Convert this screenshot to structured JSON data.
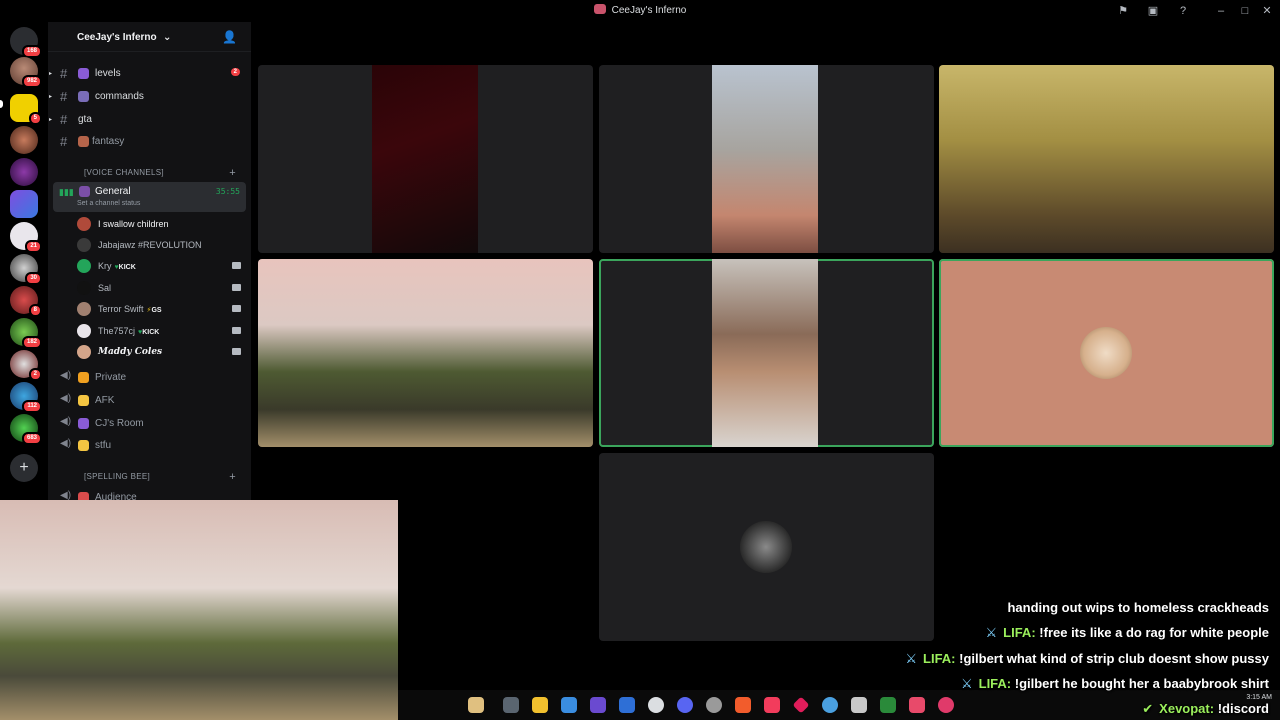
{
  "window": {
    "title": "CeeJay's Inferno"
  },
  "rail": {
    "servers": [
      {
        "icon": "discord-icon",
        "badge": "168"
      },
      {
        "icon": "server-avatar-icon",
        "badge": "982"
      },
      {
        "icon": "server-w-icon",
        "badge": "5"
      },
      {
        "icon": "server-avatar-icon",
        "badge": ""
      },
      {
        "icon": "server-avatar-icon",
        "badge": ""
      },
      {
        "icon": "server-andi-icon",
        "badge": ""
      },
      {
        "icon": "server-bunny-icon",
        "badge": "21"
      },
      {
        "icon": "server-avatar-icon",
        "badge": "30"
      },
      {
        "icon": "server-avatar-icon",
        "badge": "8"
      },
      {
        "icon": "server-avatar-icon",
        "badge": "182"
      },
      {
        "icon": "server-avatar-icon",
        "badge": "2"
      },
      {
        "icon": "server-avatar-icon",
        "badge": "112"
      },
      {
        "icon": "server-avatar-icon",
        "badge": "683"
      }
    ],
    "add_server_icon": "plus-icon"
  },
  "sidebar": {
    "server_name": "CeeJay's Inferno",
    "channels": [
      {
        "name": "levels",
        "count": "2"
      },
      {
        "name": "commands",
        "count": ""
      },
      {
        "name": "gta",
        "count": ""
      },
      {
        "name": "fantasy",
        "count": ""
      }
    ],
    "voice_category": "[VOICE CHANNELS]",
    "active_voice": {
      "name": "General",
      "time": "35:55",
      "status": "Set a channel status"
    },
    "members": [
      {
        "name": "I swallow children",
        "tag": "",
        "cam": false
      },
      {
        "name": "Jabajawz #REVOLUTION",
        "tag": "",
        "cam": false
      },
      {
        "name": "Kry",
        "tag": "KICK",
        "cam": true
      },
      {
        "name": "Sal",
        "tag": "",
        "cam": true
      },
      {
        "name": "Terror Swift",
        "tag": "GS",
        "cam": true
      },
      {
        "name": "The757cj",
        "tag": "KICK",
        "cam": true
      },
      {
        "name": "Maddy Coles",
        "tag": "",
        "cam": true
      }
    ],
    "voice_channels": [
      {
        "name": "Private"
      },
      {
        "name": "AFK"
      },
      {
        "name": "CJ's Room"
      },
      {
        "name": "stfu"
      }
    ],
    "spelling_category": "[SPELLING BEE]",
    "audience": "Audience"
  },
  "chat": [
    {
      "user": "",
      "text": "handing out wips to homeless crackheads"
    },
    {
      "user": "LIFA:",
      "text": "!free its like a do rag for white people"
    },
    {
      "user": "LIFA:",
      "text": "!gilbert what kind of strip club doesnt show pussy"
    },
    {
      "user": "LIFA:",
      "text": "!gilbert he bought her a baabybrook shirt"
    },
    {
      "user": "Xevopat:",
      "text": "!discord"
    }
  ],
  "taskbar": {
    "clock": "3:15 AM"
  },
  "colors": {
    "speaking": "#3ba55c",
    "badge": "#f23f43",
    "chat_user": "#9bef5c"
  }
}
